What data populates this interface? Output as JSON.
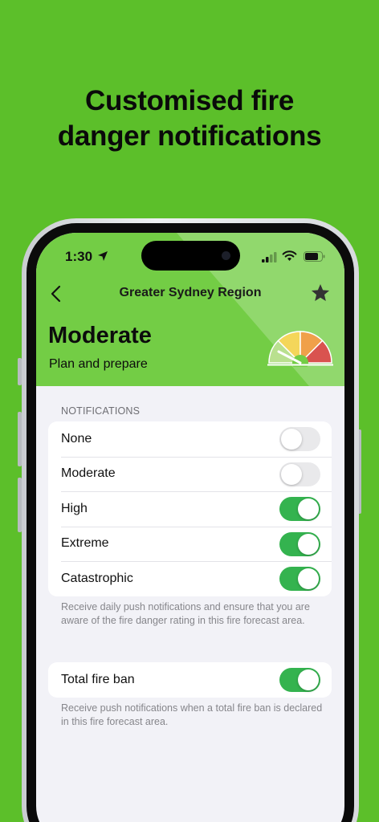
{
  "headline": {
    "line1": "Customised fire",
    "line2": "danger notifications"
  },
  "status_bar": {
    "time": "1:30"
  },
  "nav": {
    "title": "Greater Sydney Region"
  },
  "rating": {
    "level": "Moderate",
    "advice": "Plan and prepare",
    "gauge_colors": [
      "#b9e08f",
      "#f4d65a",
      "#f0a04a",
      "#d9534f"
    ]
  },
  "notifications": {
    "section_label": "NOTIFICATIONS",
    "items": [
      {
        "label": "None",
        "enabled": false
      },
      {
        "label": "Moderate",
        "enabled": false
      },
      {
        "label": "High",
        "enabled": true
      },
      {
        "label": "Extreme",
        "enabled": true
      },
      {
        "label": "Catastrophic",
        "enabled": true
      }
    ],
    "footnote": "Receive daily push notifications and ensure that you are aware of the fire danger rating in this fire forecast area."
  },
  "total_fire_ban": {
    "label": "Total fire ban",
    "enabled": true,
    "footnote": "Receive push notifications when a total fire ban is declared in this fire forecast area."
  },
  "colors": {
    "background": "#5cbf2a",
    "header": "#73cd45",
    "toggle_on": "#34b34f"
  }
}
